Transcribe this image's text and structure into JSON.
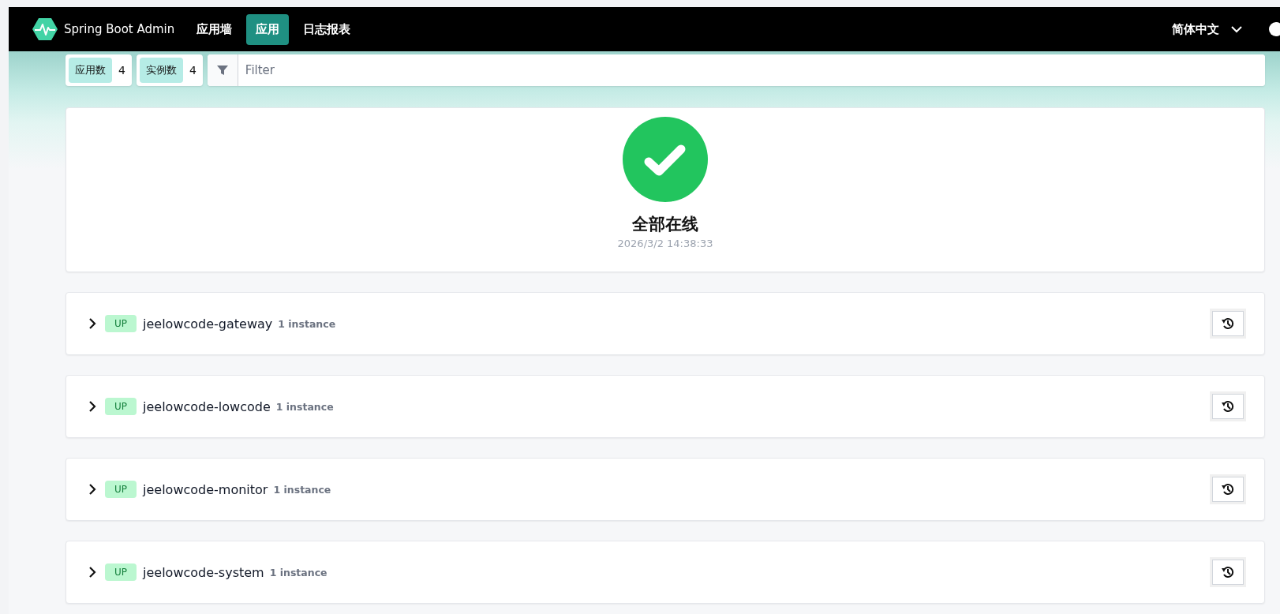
{
  "navbar": {
    "brand": "Spring Boot Admin",
    "items": [
      {
        "label": "应用墙",
        "selected": false
      },
      {
        "label": "应用",
        "selected": true
      },
      {
        "label": "日志报表",
        "selected": false
      }
    ],
    "language": "简体中文"
  },
  "toolbar": {
    "stats": [
      {
        "label": "应用数",
        "value": "4"
      },
      {
        "label": "实例数",
        "value": "4"
      }
    ],
    "filter": {
      "placeholder": "Filter"
    }
  },
  "status": {
    "title": "全部在线",
    "time": "2026/3/2 14:38:33"
  },
  "applications": [
    {
      "status": "UP",
      "name": "jeelowcode-gateway",
      "instances": "1 instance",
      "expanded": false
    },
    {
      "status": "UP",
      "name": "jeelowcode-lowcode",
      "instances": "1 instance",
      "expanded": false
    },
    {
      "status": "UP",
      "name": "jeelowcode-monitor",
      "instances": "1 instance",
      "expanded": false
    },
    {
      "status": "UP",
      "name": "jeelowcode-system",
      "instances": "1 instance",
      "expanded": false
    }
  ]
}
